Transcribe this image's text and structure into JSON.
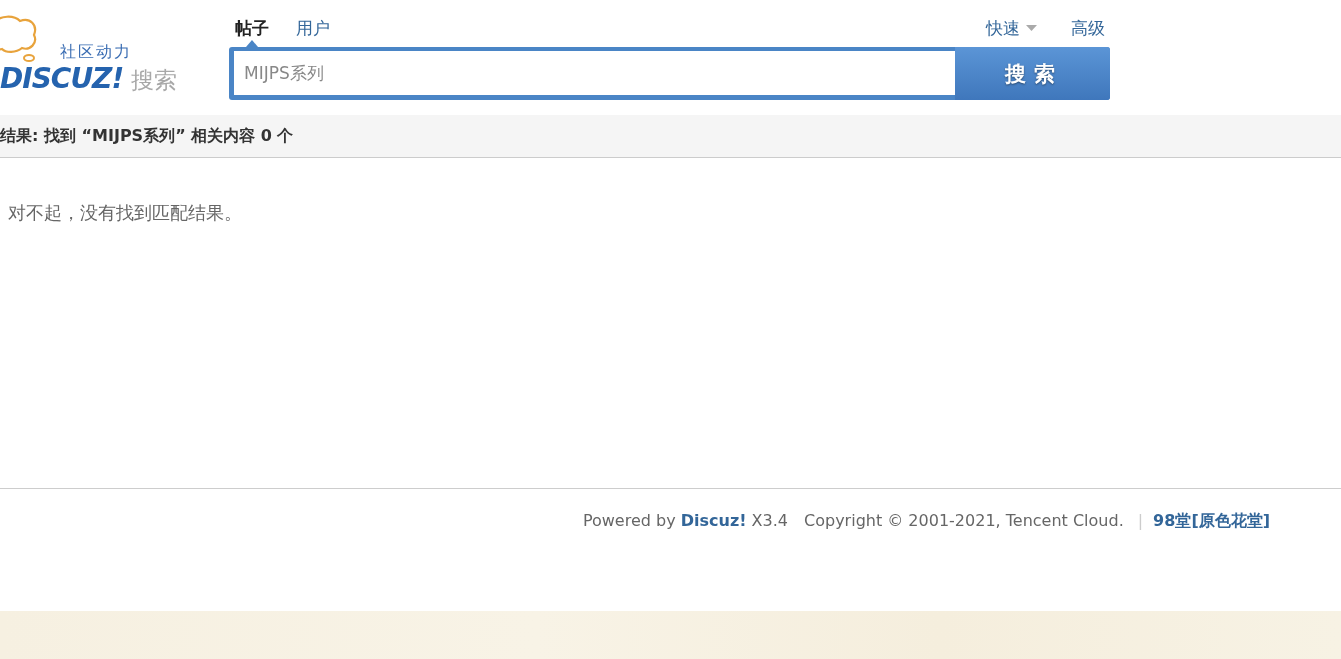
{
  "logo": {
    "tagline": "社区动力",
    "wordmark": "DISCUZ!",
    "suffix": "搜索"
  },
  "search": {
    "tabs": [
      {
        "label": "帖子",
        "selected": true
      },
      {
        "label": "用户",
        "selected": false
      }
    ],
    "links": [
      {
        "label": "快速",
        "kind": "dropdown"
      },
      {
        "label": "高级",
        "kind": "link"
      }
    ],
    "value": "MIJPS系列",
    "button": "搜索"
  },
  "result_bar": {
    "title": "结果: 找到 “MIJPS系列” 相关内容 0 个"
  },
  "message": "对不起，没有找到匹配结果。",
  "footer": {
    "powered_by": {
      "before": "Powered by",
      "link": "Discuz!",
      "after": "X3.4"
    },
    "copyright": "Copyright © 2001-2021, Tencent Cloud.",
    "separator": "|",
    "site_link": "98堂[原色花堂]"
  }
}
